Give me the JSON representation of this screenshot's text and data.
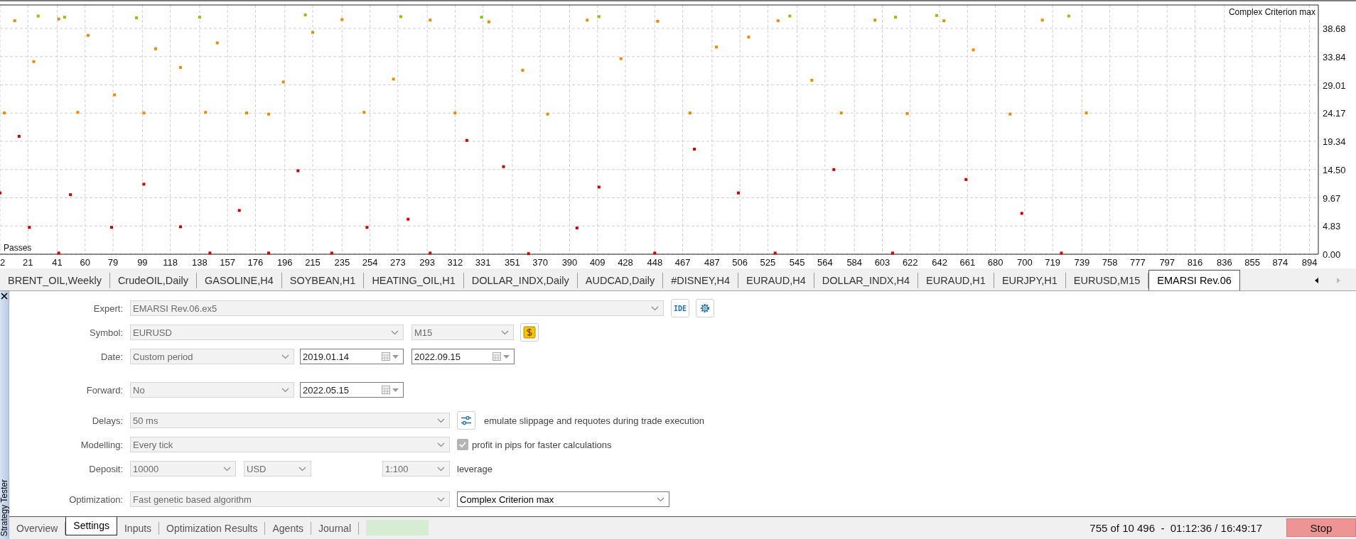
{
  "chart": {
    "chart_data": {
      "type": "scatter",
      "title": "Complex Criterion max",
      "xlabel": "Passes",
      "grid": true,
      "xlim": [
        2,
        900
      ],
      "ylim": [
        0,
        42.7
      ],
      "x": [
        28,
        46,
        95,
        138,
        210,
        275,
        330,
        410,
        540,
        612,
        640,
        730,
        5,
        12,
        25,
        42,
        55,
        62,
        80,
        100,
        108,
        125,
        142,
        150,
        170,
        185,
        195,
        215,
        235,
        250,
        270,
        295,
        312,
        335,
        358,
        375,
        402,
        425,
        450,
        472,
        490,
        512,
        532,
        555,
        575,
        598,
        620,
        645,
        665,
        690,
        712,
        742,
        2,
        15,
        22,
        42,
        50,
        78,
        100,
        125,
        145,
        165,
        185,
        205,
        228,
        252,
        280,
        295,
        320,
        345,
        362,
        395,
        410,
        448,
        475,
        505,
        530,
        570,
        610,
        660,
        698,
        725
      ],
      "xticks": [
        2,
        21,
        41,
        60,
        79,
        99,
        118,
        138,
        157,
        176,
        196,
        215,
        235,
        254,
        273,
        293,
        312,
        331,
        351,
        370,
        390,
        409,
        428,
        448,
        467,
        487,
        506,
        525,
        545,
        564,
        584,
        603,
        622,
        642,
        661,
        680,
        700,
        719,
        739,
        758,
        777,
        797,
        816,
        836,
        855,
        874,
        894
      ],
      "yticks": [
        {
          "value": 0,
          "label": "0.00"
        },
        {
          "value": 4.835,
          "label": "4.83"
        },
        {
          "value": 9.67,
          "label": "9.67"
        },
        {
          "value": 14.505,
          "label": "14.50"
        },
        {
          "value": 19.34,
          "label": "19.34"
        },
        {
          "value": 24.175,
          "label": "24.17"
        },
        {
          "value": 29.01,
          "label": "29.01"
        },
        {
          "value": 33.845,
          "label": "33.84"
        },
        {
          "value": 38.68,
          "label": "38.68"
        }
      ],
      "series": [
        {
          "color": "#8cc414",
          "values": [
            40.8,
            40.6,
            40.5,
            40.6,
            41.0,
            40.7,
            40.6,
            40.7,
            40.8,
            40.6,
            40.9,
            40.8,
            null,
            null,
            null,
            null,
            null,
            null,
            null,
            null,
            null,
            null,
            null,
            null,
            null,
            null,
            null,
            null,
            null,
            null,
            null,
            null,
            null,
            null,
            null,
            null,
            null,
            null,
            null,
            null,
            null,
            null,
            null,
            null,
            null,
            null,
            null,
            null,
            null,
            null,
            null,
            null,
            null,
            null,
            null,
            null,
            null,
            null,
            null,
            null,
            null,
            null,
            null,
            null,
            null,
            null,
            null,
            null,
            null,
            null,
            null,
            null,
            null,
            null,
            null,
            null,
            null,
            null,
            null,
            null,
            null,
            null
          ]
        },
        {
          "color": "#f08a00",
          "values": [
            null,
            null,
            null,
            null,
            null,
            null,
            null,
            null,
            null,
            null,
            null,
            null,
            24.2,
            40.0,
            33.0,
            40.3,
            24.3,
            37.5,
            27.3,
            24.2,
            35.2,
            32.0,
            24.3,
            36.2,
            24.2,
            24.0,
            29.5,
            38.0,
            40.2,
            24.3,
            30.0,
            40.1,
            24.2,
            39.8,
            31.5,
            24.0,
            40.1,
            33.5,
            39.9,
            24.2,
            35.5,
            37.2,
            40.0,
            29.8,
            24.2,
            40.1,
            24.1,
            40.0,
            35.0,
            24.0,
            40.1,
            24.2,
            null,
            null,
            null,
            null,
            null,
            null,
            null,
            null,
            null,
            null,
            null,
            null,
            null,
            null,
            null,
            null,
            null,
            null,
            null,
            null,
            null,
            null,
            null,
            null,
            null,
            null,
            null,
            null,
            null,
            null
          ]
        },
        {
          "color": "#d40000",
          "values": [
            null,
            null,
            null,
            null,
            null,
            null,
            null,
            null,
            null,
            null,
            null,
            null,
            null,
            null,
            null,
            null,
            null,
            null,
            null,
            null,
            null,
            null,
            null,
            null,
            null,
            null,
            null,
            null,
            null,
            null,
            null,
            null,
            null,
            null,
            null,
            null,
            null,
            null,
            null,
            null,
            null,
            null,
            null,
            null,
            null,
            null,
            null,
            null,
            null,
            null,
            null,
            null,
            10.5,
            20.2,
            4.6,
            0.2,
            10.2,
            4.6,
            12.0,
            4.7,
            0.2,
            7.5,
            0.2,
            14.3,
            0.2,
            4.6,
            6.0,
            0.2,
            19.5,
            15.0,
            0.1,
            4.5,
            11.5,
            0.2,
            18.0,
            10.5,
            0.2,
            14.5,
            0.2,
            12.8,
            7.0,
            0.2
          ]
        }
      ]
    }
  },
  "tabs": [
    {
      "label": "BRENT_OIL,Weekly",
      "selected": false
    },
    {
      "label": "CrudeOIL,Daily",
      "selected": false
    },
    {
      "label": "GASOLINE,H4",
      "selected": false
    },
    {
      "label": "SOYBEAN,H1",
      "selected": false
    },
    {
      "label": "HEATING_OIL,H1",
      "selected": false
    },
    {
      "label": "DOLLAR_INDX,Daily",
      "selected": false
    },
    {
      "label": "AUDCAD,Daily",
      "selected": false
    },
    {
      "label": "#DISNEY,H4",
      "selected": false
    },
    {
      "label": "EURAUD,H4",
      "selected": false
    },
    {
      "label": "DOLLAR_INDX,H4",
      "selected": false
    },
    {
      "label": "EURAUD,H1",
      "selected": false
    },
    {
      "label": "EURJPY,H1",
      "selected": false
    },
    {
      "label": "EURUSD,M15",
      "selected": false
    },
    {
      "label": "EMARSI Rev.06",
      "selected": true
    }
  ],
  "panel": {
    "title": "Strategy Tester"
  },
  "settings": [
    {
      "label": "Expert:",
      "items": [
        {
          "kind": "select",
          "value": "EMARSI Rev.06.ex5",
          "disabled": true
        },
        {
          "kind": "text-button",
          "text": "IDE"
        },
        {
          "kind": "gear-button"
        }
      ]
    },
    {
      "label": "Symbol:",
      "items": [
        {
          "kind": "select",
          "value": "EURUSD",
          "disabled": true
        },
        {
          "kind": "select",
          "value": "M15",
          "disabled": true
        },
        {
          "kind": "dollar-button"
        }
      ]
    },
    {
      "label": "Date:",
      "items": [
        {
          "kind": "select",
          "value": "Custom period",
          "disabled": true
        },
        {
          "kind": "date",
          "value": "2019.01.14",
          "disabled": false
        },
        {
          "kind": "date",
          "value": "2022.09.15",
          "disabled": false
        }
      ]
    },
    {
      "label": "Forward:",
      "items": [
        {
          "kind": "select",
          "value": "No",
          "disabled": true
        },
        {
          "kind": "date",
          "value": "2022.05.15",
          "disabled": false
        }
      ]
    },
    {
      "label": "Delays:",
      "items": [
        {
          "kind": "select",
          "value": "50 ms",
          "disabled": true
        },
        {
          "kind": "sliders-button"
        },
        {
          "kind": "note",
          "text": "emulate slippage and requotes during trade execution"
        }
      ]
    },
    {
      "label": "Modelling:",
      "items": [
        {
          "kind": "select",
          "value": "Every tick",
          "disabled": true
        },
        {
          "kind": "checkbox",
          "text": "profit in pips for faster calculations",
          "checked": true,
          "disabled": true
        }
      ]
    },
    {
      "label": "Deposit:",
      "items": [
        {
          "kind": "select",
          "value": "10000",
          "disabled": true
        },
        {
          "kind": "select",
          "value": "USD",
          "disabled": true
        },
        {
          "kind": "select",
          "value": "1:100",
          "disabled": true
        },
        {
          "kind": "note",
          "text": "leverage"
        }
      ]
    },
    {
      "label": "Optimization:",
      "items": [
        {
          "kind": "select",
          "value": "Fast genetic based algorithm",
          "disabled": true
        },
        {
          "kind": "select",
          "value": "Complex Criterion max",
          "disabled": false
        }
      ]
    }
  ],
  "bottom_tabs": [
    {
      "label": "Overview",
      "selected": false
    },
    {
      "label": "Settings",
      "selected": true
    },
    {
      "label": "Inputs",
      "selected": false
    },
    {
      "label": "Optimization Results",
      "selected": false
    },
    {
      "label": "Agents",
      "selected": false
    },
    {
      "label": "Journal",
      "selected": false
    }
  ],
  "progress": {
    "level": 1
  },
  "status": "755 of 10 496  -  01:12:36 / 16:49:17",
  "stop_button": "Stop"
}
